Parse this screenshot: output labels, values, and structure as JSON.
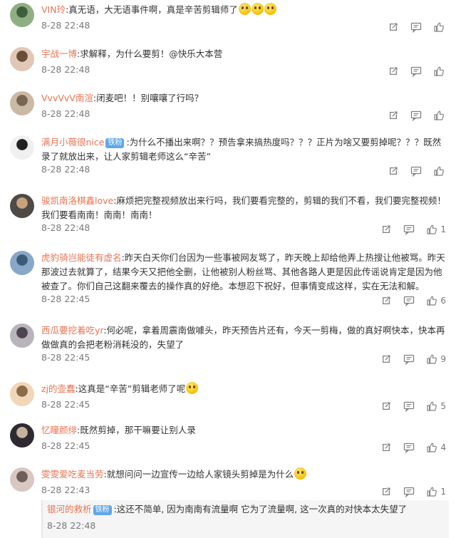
{
  "comments": [
    {
      "user": "VIN玲",
      "badge": "",
      "text": ":真无语，大无语事件啊，真是辛苦剪辑师了",
      "emoji_count": 3,
      "time": "8-28 22:48",
      "likes": ""
    },
    {
      "user": "宇战一博",
      "badge": "",
      "text": ":求解释，为什么要剪！@快乐大本营",
      "emoji_count": 0,
      "time": "8-28 22:48",
      "likes": ""
    },
    {
      "user": "VvvVvV南渲",
      "badge": "",
      "text": ":闭麦吧！！别嚷嚷了行吗？",
      "emoji_count": 0,
      "time": "8-28 22:48",
      "likes": ""
    },
    {
      "user": "满月小薇很nice",
      "badge": "铁粉",
      "text": ":为什么不播出来啊？？预告拿来搞热度吗？？？正片为啥又要剪掉呢？？？既然录了就放出来，让人家剪辑老师这么“辛苦”",
      "emoji_count": 0,
      "time": "8-28 22:48",
      "likes": ""
    },
    {
      "user": "骏凯南洛棋鑫love",
      "badge": "",
      "text": ":麻烦把完整视频放出来行吗，我们要看完整的，剪辑的我们不看，我们要完整视频！我们要看南南！南南！南南！",
      "emoji_count": 0,
      "time": "8-28 22:48",
      "likes": "1"
    },
    {
      "user": "虎豹骑岂能徒有虚名",
      "badge": "",
      "text": ":昨天白天你们台因为一些事被网友骂了，昨天晚上却给他弄上热搜让他被骂。昨天那波过去就算了，结果今天又把他全删，让他被别人粉丝骂、其他各路人更是因此传谣说肯定是因为他被查了。你们自己这翻来覆去的操作真的好绝。本想忍下祝好，但事情变成这样，实在无法和解。",
      "emoji_count": 0,
      "time": "8-28 22:45",
      "likes": "6"
    },
    {
      "user": "西瓜要挖着吃yr",
      "badge": "",
      "text": ":何必呢，拿着周震南做噱头，昨天预告片还有，今天一剪梅，做的真好啊快本，快本再做做真的会把老粉消耗没的，失望了",
      "emoji_count": 0,
      "time": "8-28 22:45",
      "likes": "9"
    },
    {
      "user": "zj的壶蠢",
      "badge": "",
      "text": ":这真是“辛苦”剪辑老师了呢",
      "emoji_count": 1,
      "time": "8-28 22:45",
      "likes": "5"
    },
    {
      "user": "忆瞳颜绯",
      "badge": "",
      "text": ":既然剪掉，那干嘛要让别人录",
      "emoji_count": 0,
      "time": "8-28 22:45",
      "likes": "4"
    },
    {
      "user": "雯雯爱吃麦当劳",
      "badge": "",
      "text": ":就想问问一边宣传一边给人家镜头剪掉是为什么",
      "emoji_count": 1,
      "time": "8-28 22:43",
      "likes": "1"
    }
  ],
  "reply": {
    "user": "银河的救析",
    "badge": "铁粉",
    "text": ":这还不简单, 因为南南有流量啊 它为了流量啊, 这一次真的对快本太失望了",
    "time": "8-28 22:48"
  },
  "colors": {
    "username": "#eb7350",
    "badge": "#5fa8e8",
    "meta": "#7a7a7a"
  },
  "icons": [
    "share-icon",
    "comment-icon",
    "like-icon"
  ]
}
